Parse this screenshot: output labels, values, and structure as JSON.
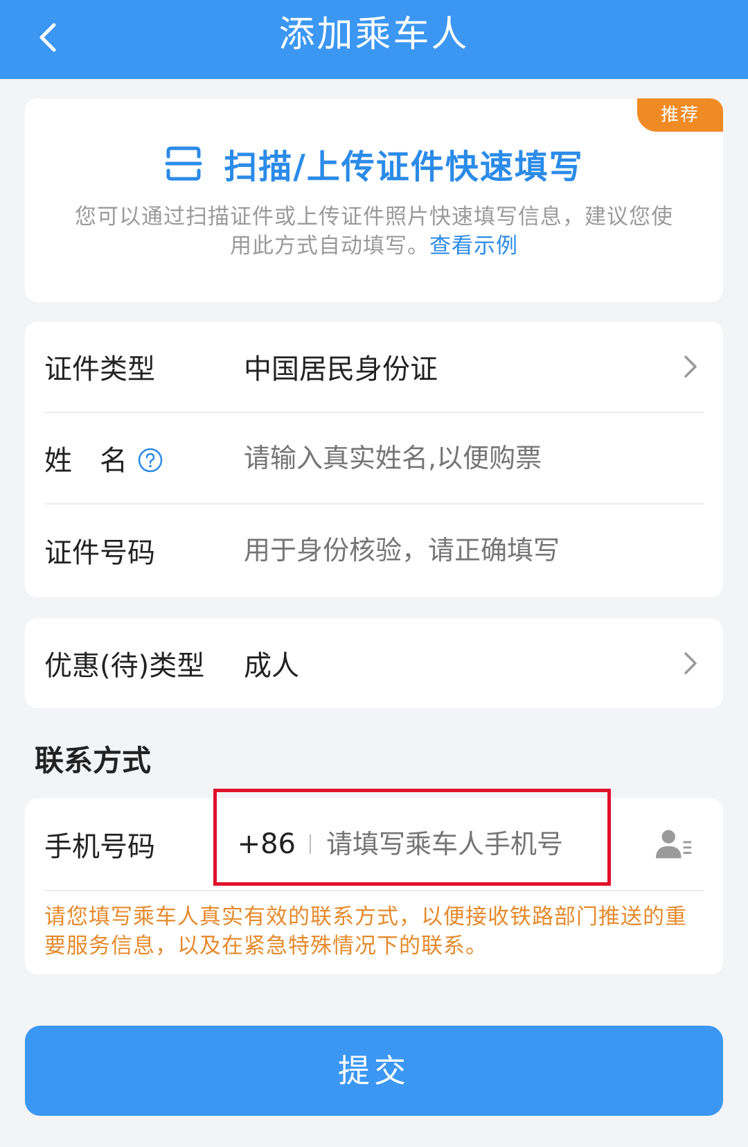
{
  "header": {
    "title": "添加乘车人"
  },
  "scan_card": {
    "badge": "推荐",
    "title": "扫描/上传证件快速填写",
    "description": "您可以通过扫描证件或上传证件照片快速填写信息，建议您使用此方式自动填写。",
    "example_link": "查看示例"
  },
  "form": {
    "id_type_label": "证件类型",
    "id_type_value": "中国居民身份证",
    "name_label": "姓　名",
    "name_placeholder": "请输入真实姓名,以便购票",
    "id_number_label": "证件号码",
    "id_number_placeholder": "用于身份核验，请正确填写"
  },
  "discount": {
    "label": "优惠(待)类型",
    "value": "成人"
  },
  "contact": {
    "section_title": "联系方式",
    "phone_label": "手机号码",
    "country_code": "+86",
    "phone_placeholder": "请填写乘车人手机号",
    "notice": "请您填写乘车人真实有效的联系方式，以便接收铁路部门推送的重要服务信息，以及在紧急特殊情况下的联系。"
  },
  "submit_label": "提交",
  "colors": {
    "primary": "#3c97f2",
    "link": "#2b8be8",
    "badge": "#f08a24",
    "notice": "#e58a2c",
    "highlight": "#e0102a"
  },
  "icons": {
    "back": "back-arrow-icon",
    "scan": "scan-icon",
    "help": "question-circle-icon",
    "chevron": "chevron-right-icon",
    "contact": "contact-book-icon"
  }
}
